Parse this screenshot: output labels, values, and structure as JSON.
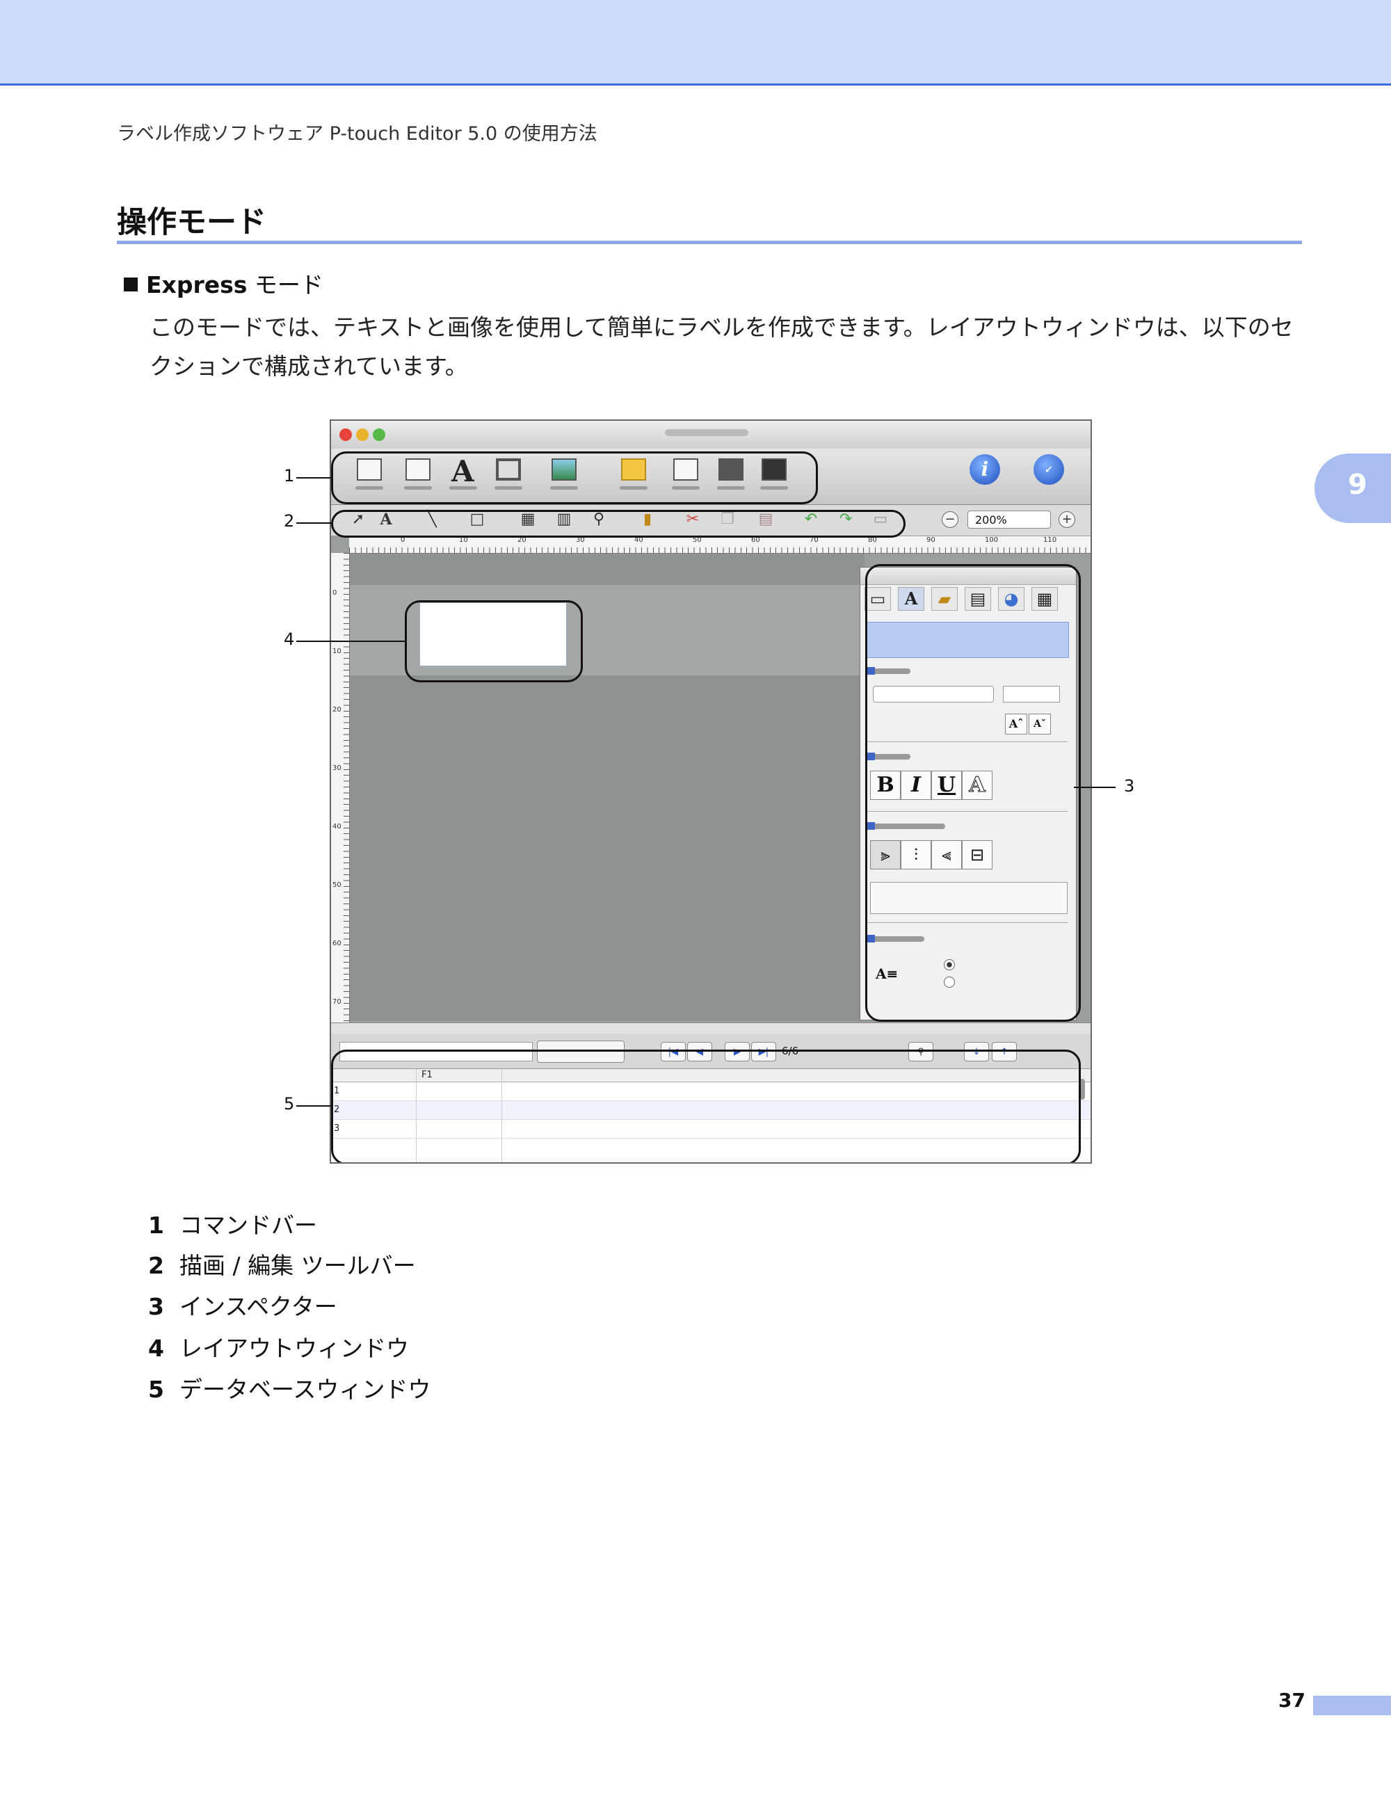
{
  "header": {
    "running_title": "ラベル作成ソフトウェア P-touch Editor 5.0 の使用方法"
  },
  "chapter_tab": "9",
  "section": {
    "title": "操作モード"
  },
  "bullet": {
    "strong": "Express",
    "rest": " モード"
  },
  "paragraph": "このモードでは、テキストと画像を使用して簡単にラベルを作成できます。レイアウトウィンドウは、以下のセクションで構成されています。",
  "screenshot": {
    "zoom_value": "200%",
    "zoom_minus": "−",
    "zoom_plus": "+",
    "ruler_h": [
      "0",
      "10",
      "20",
      "30",
      "40",
      "50",
      "60",
      "70",
      "80",
      "90",
      "100",
      "110"
    ],
    "ruler_v": [
      "0",
      "10",
      "20",
      "30",
      "40",
      "50",
      "60",
      "70"
    ],
    "inspector_text_icon": "A",
    "inspector_size_buttons": [
      "Aˆ",
      "Aˇ"
    ],
    "style_buttons": [
      "B",
      "I",
      "U",
      "A"
    ],
    "align_buttons": [
      "⫸",
      "⫶",
      "⫷",
      "⊟"
    ],
    "direction_icon": "A≡",
    "record_counter": "6/6",
    "db_column": "F1",
    "db_rows": [
      "1",
      "2",
      "3"
    ],
    "callouts": [
      "1",
      "2",
      "3",
      "4",
      "5"
    ]
  },
  "legend": [
    {
      "num": "1",
      "label": "コマンドバー"
    },
    {
      "num": "2",
      "label": "描画 / 編集 ツールバー"
    },
    {
      "num": "3",
      "label": "インスペクター"
    },
    {
      "num": "4",
      "label": "レイアウトウィンドウ"
    },
    {
      "num": "5",
      "label": "データベースウィンドウ"
    }
  ],
  "page_number": "37",
  "colors": {
    "header_band": "#cfdcfb",
    "rule": "#8fa8ea",
    "tab": "#a9bdf0"
  }
}
